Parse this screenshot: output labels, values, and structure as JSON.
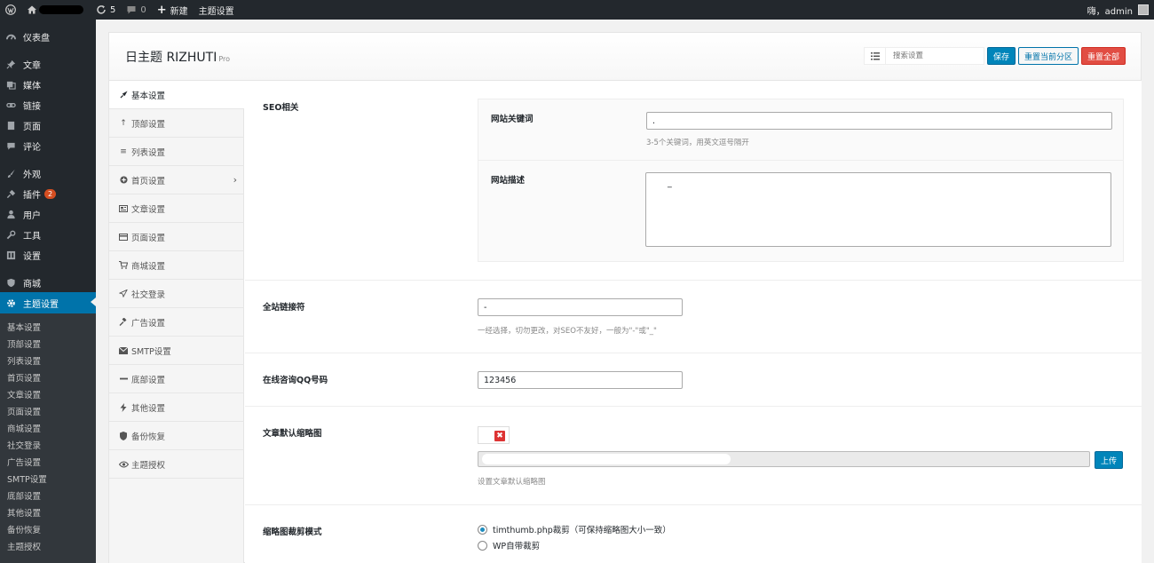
{
  "adminbar": {
    "updates_count": "5",
    "comments_count": "0",
    "new_label": "新建",
    "theme_settings_label": "主题设置",
    "greeting": "嗨，admin"
  },
  "admin_menu": [
    {
      "label": "仪表盘",
      "icon": "dashboard-icon"
    },
    {
      "label": "文章",
      "icon": "pin-icon"
    },
    {
      "label": "媒体",
      "icon": "media-icon"
    },
    {
      "label": "链接",
      "icon": "link-icon"
    },
    {
      "label": "页面",
      "icon": "page-icon"
    },
    {
      "label": "评论",
      "icon": "comment-icon"
    },
    {
      "label": "外观",
      "icon": "brush-icon"
    },
    {
      "label": "插件",
      "icon": "plugin-icon",
      "badge": "2"
    },
    {
      "label": "用户",
      "icon": "user-icon"
    },
    {
      "label": "工具",
      "icon": "wrench-icon"
    },
    {
      "label": "设置",
      "icon": "settings-icon"
    },
    {
      "label": "商城",
      "icon": "shield-icon"
    },
    {
      "label": "主题设置",
      "icon": "gear-icon",
      "current": true
    }
  ],
  "submenu": [
    "基本设置",
    "顶部设置",
    "列表设置",
    "首页设置",
    "文章设置",
    "页面设置",
    "商城设置",
    "社交登录",
    "广告设置",
    "SMTP设置",
    "底部设置",
    "其他设置",
    "备份恢复",
    "主题授权"
  ],
  "panel": {
    "title": "日主题 RIZHUTI",
    "title_suffix": "Pro",
    "search_placeholder": "搜索设置",
    "save_label": "保存",
    "reset_section_label": "重置当前分区",
    "reset_all_label": "重置全部"
  },
  "sections": [
    {
      "label": "基本设置",
      "icon": "rocket-icon",
      "active": true
    },
    {
      "label": "顶部设置",
      "icon": "arrow-up-icon"
    },
    {
      "label": "列表设置",
      "icon": "list-icon"
    },
    {
      "label": "首页设置",
      "icon": "plus-circle-icon",
      "has_children": true
    },
    {
      "label": "文章设置",
      "icon": "newspaper-icon"
    },
    {
      "label": "页面设置",
      "icon": "card-icon"
    },
    {
      "label": "商城设置",
      "icon": "cart-icon"
    },
    {
      "label": "社交登录",
      "icon": "paper-plane-icon"
    },
    {
      "label": "广告设置",
      "icon": "gavel-icon"
    },
    {
      "label": "SMTP设置",
      "icon": "envelope-icon"
    },
    {
      "label": "底部设置",
      "icon": "minus-icon"
    },
    {
      "label": "其他设置",
      "icon": "bolt-icon"
    },
    {
      "label": "备份恢复",
      "icon": "shield-icon"
    },
    {
      "label": "主题授权",
      "icon": "eye-icon"
    }
  ],
  "fields": {
    "seo": {
      "label": "SEO相关",
      "keywords_label": "网站关键词",
      "keywords_value": ".",
      "keywords_desc": "3-5个关键词，用英文逗号隔开",
      "description_label": "网站描述",
      "description_value": "_"
    },
    "separator": {
      "label": "全站链接符",
      "value": "-",
      "desc": "一经选择，切勿更改，对SEO不友好，一般为\"-\"或\"_\""
    },
    "qq": {
      "label": "在线咨询QQ号码",
      "value": "123456"
    },
    "thumbnail": {
      "label": "文章默认缩略图",
      "upload_label": "上传",
      "desc": "设置文章默认缩略图"
    },
    "crop": {
      "label": "缩略图裁剪模式",
      "options": [
        "timthumb.php裁剪（可保持缩略图大小一致）",
        "WP自带裁剪"
      ],
      "selected": 0
    }
  }
}
